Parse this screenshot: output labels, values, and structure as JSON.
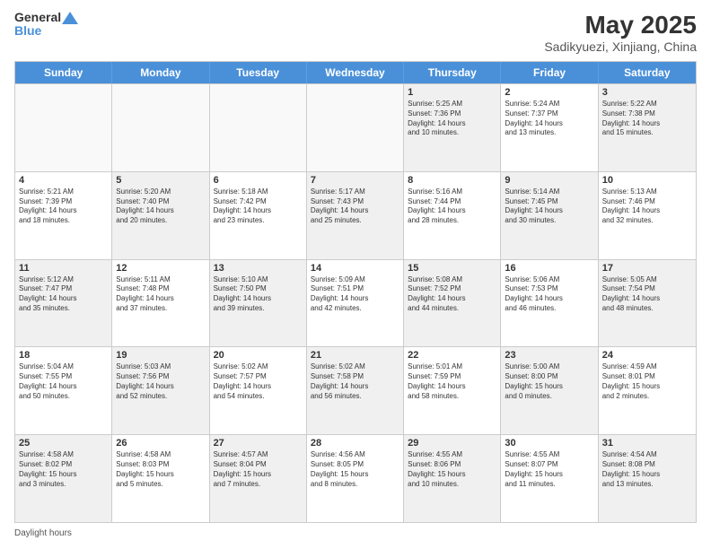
{
  "header": {
    "logo_line1": "General",
    "logo_line2": "Blue",
    "title": "May 2025",
    "subtitle": "Sadikyuezi, Xinjiang, China"
  },
  "weekdays": [
    "Sunday",
    "Monday",
    "Tuesday",
    "Wednesday",
    "Thursday",
    "Friday",
    "Saturday"
  ],
  "rows": [
    [
      {
        "day": "",
        "text": "",
        "empty": true
      },
      {
        "day": "",
        "text": "",
        "empty": true
      },
      {
        "day": "",
        "text": "",
        "empty": true
      },
      {
        "day": "",
        "text": "",
        "empty": true
      },
      {
        "day": "1",
        "text": "Sunrise: 5:25 AM\nSunset: 7:36 PM\nDaylight: 14 hours\nand 10 minutes.",
        "shaded": true
      },
      {
        "day": "2",
        "text": "Sunrise: 5:24 AM\nSunset: 7:37 PM\nDaylight: 14 hours\nand 13 minutes.",
        "shaded": false
      },
      {
        "day": "3",
        "text": "Sunrise: 5:22 AM\nSunset: 7:38 PM\nDaylight: 14 hours\nand 15 minutes.",
        "shaded": true
      }
    ],
    [
      {
        "day": "4",
        "text": "Sunrise: 5:21 AM\nSunset: 7:39 PM\nDaylight: 14 hours\nand 18 minutes.",
        "shaded": false
      },
      {
        "day": "5",
        "text": "Sunrise: 5:20 AM\nSunset: 7:40 PM\nDaylight: 14 hours\nand 20 minutes.",
        "shaded": true
      },
      {
        "day": "6",
        "text": "Sunrise: 5:18 AM\nSunset: 7:42 PM\nDaylight: 14 hours\nand 23 minutes.",
        "shaded": false
      },
      {
        "day": "7",
        "text": "Sunrise: 5:17 AM\nSunset: 7:43 PM\nDaylight: 14 hours\nand 25 minutes.",
        "shaded": true
      },
      {
        "day": "8",
        "text": "Sunrise: 5:16 AM\nSunset: 7:44 PM\nDaylight: 14 hours\nand 28 minutes.",
        "shaded": false
      },
      {
        "day": "9",
        "text": "Sunrise: 5:14 AM\nSunset: 7:45 PM\nDaylight: 14 hours\nand 30 minutes.",
        "shaded": true
      },
      {
        "day": "10",
        "text": "Sunrise: 5:13 AM\nSunset: 7:46 PM\nDaylight: 14 hours\nand 32 minutes.",
        "shaded": false
      }
    ],
    [
      {
        "day": "11",
        "text": "Sunrise: 5:12 AM\nSunset: 7:47 PM\nDaylight: 14 hours\nand 35 minutes.",
        "shaded": true
      },
      {
        "day": "12",
        "text": "Sunrise: 5:11 AM\nSunset: 7:48 PM\nDaylight: 14 hours\nand 37 minutes.",
        "shaded": false
      },
      {
        "day": "13",
        "text": "Sunrise: 5:10 AM\nSunset: 7:50 PM\nDaylight: 14 hours\nand 39 minutes.",
        "shaded": true
      },
      {
        "day": "14",
        "text": "Sunrise: 5:09 AM\nSunset: 7:51 PM\nDaylight: 14 hours\nand 42 minutes.",
        "shaded": false
      },
      {
        "day": "15",
        "text": "Sunrise: 5:08 AM\nSunset: 7:52 PM\nDaylight: 14 hours\nand 44 minutes.",
        "shaded": true
      },
      {
        "day": "16",
        "text": "Sunrise: 5:06 AM\nSunset: 7:53 PM\nDaylight: 14 hours\nand 46 minutes.",
        "shaded": false
      },
      {
        "day": "17",
        "text": "Sunrise: 5:05 AM\nSunset: 7:54 PM\nDaylight: 14 hours\nand 48 minutes.",
        "shaded": true
      }
    ],
    [
      {
        "day": "18",
        "text": "Sunrise: 5:04 AM\nSunset: 7:55 PM\nDaylight: 14 hours\nand 50 minutes.",
        "shaded": false
      },
      {
        "day": "19",
        "text": "Sunrise: 5:03 AM\nSunset: 7:56 PM\nDaylight: 14 hours\nand 52 minutes.",
        "shaded": true
      },
      {
        "day": "20",
        "text": "Sunrise: 5:02 AM\nSunset: 7:57 PM\nDaylight: 14 hours\nand 54 minutes.",
        "shaded": false
      },
      {
        "day": "21",
        "text": "Sunrise: 5:02 AM\nSunset: 7:58 PM\nDaylight: 14 hours\nand 56 minutes.",
        "shaded": true
      },
      {
        "day": "22",
        "text": "Sunrise: 5:01 AM\nSunset: 7:59 PM\nDaylight: 14 hours\nand 58 minutes.",
        "shaded": false
      },
      {
        "day": "23",
        "text": "Sunrise: 5:00 AM\nSunset: 8:00 PM\nDaylight: 15 hours\nand 0 minutes.",
        "shaded": true
      },
      {
        "day": "24",
        "text": "Sunrise: 4:59 AM\nSunset: 8:01 PM\nDaylight: 15 hours\nand 2 minutes.",
        "shaded": false
      }
    ],
    [
      {
        "day": "25",
        "text": "Sunrise: 4:58 AM\nSunset: 8:02 PM\nDaylight: 15 hours\nand 3 minutes.",
        "shaded": true
      },
      {
        "day": "26",
        "text": "Sunrise: 4:58 AM\nSunset: 8:03 PM\nDaylight: 15 hours\nand 5 minutes.",
        "shaded": false
      },
      {
        "day": "27",
        "text": "Sunrise: 4:57 AM\nSunset: 8:04 PM\nDaylight: 15 hours\nand 7 minutes.",
        "shaded": true
      },
      {
        "day": "28",
        "text": "Sunrise: 4:56 AM\nSunset: 8:05 PM\nDaylight: 15 hours\nand 8 minutes.",
        "shaded": false
      },
      {
        "day": "29",
        "text": "Sunrise: 4:55 AM\nSunset: 8:06 PM\nDaylight: 15 hours\nand 10 minutes.",
        "shaded": true
      },
      {
        "day": "30",
        "text": "Sunrise: 4:55 AM\nSunset: 8:07 PM\nDaylight: 15 hours\nand 11 minutes.",
        "shaded": false
      },
      {
        "day": "31",
        "text": "Sunrise: 4:54 AM\nSunset: 8:08 PM\nDaylight: 15 hours\nand 13 minutes.",
        "shaded": true
      }
    ]
  ],
  "footer": "Daylight hours"
}
